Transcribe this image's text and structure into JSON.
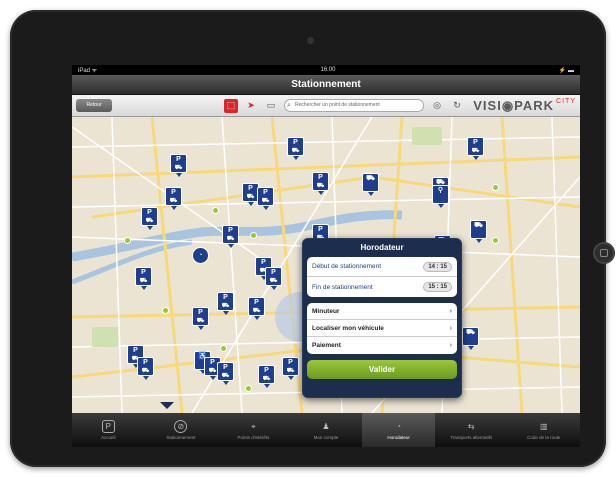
{
  "status": {
    "left": "iPad ᯤ",
    "time": "16:00",
    "right": "⚡ ▬"
  },
  "title": "Stationnement",
  "toolbar": {
    "back_label": "Retour",
    "search_placeholder": "Rechercher un point de stationnement",
    "logo": "VISI◉PARK",
    "logo_suffix": "CITY",
    "icons": [
      "parking-sign-icon",
      "location-arrow-icon",
      "map-icon",
      "target-icon",
      "refresh-icon"
    ]
  },
  "horodateur": {
    "title": "Horodateur",
    "start_label": "Début de stationnement",
    "start_time": "14 : 15",
    "end_label": "Fin de stationnement",
    "end_time": "15 : 15",
    "menu": [
      "Minuteur",
      "Localiser mon véhicule",
      "Paiement"
    ],
    "validate_label": "Valider"
  },
  "tabs": [
    {
      "label": "Accueil",
      "icon": "P"
    },
    {
      "label": "Stationnement",
      "icon": "⊘"
    },
    {
      "label": "Points d'intérêts",
      "icon": "⌖"
    },
    {
      "label": "Mon compte",
      "icon": "♟"
    },
    {
      "label": "Horodateur",
      "icon": "◔"
    },
    {
      "label": "Transports alternatifs",
      "icon": "⇆"
    },
    {
      "label": "Code de la route",
      "icon": "▥"
    }
  ],
  "colors": {
    "accent": "#1f3f8e",
    "green": "#7ab02a",
    "red": "#d9262a"
  }
}
